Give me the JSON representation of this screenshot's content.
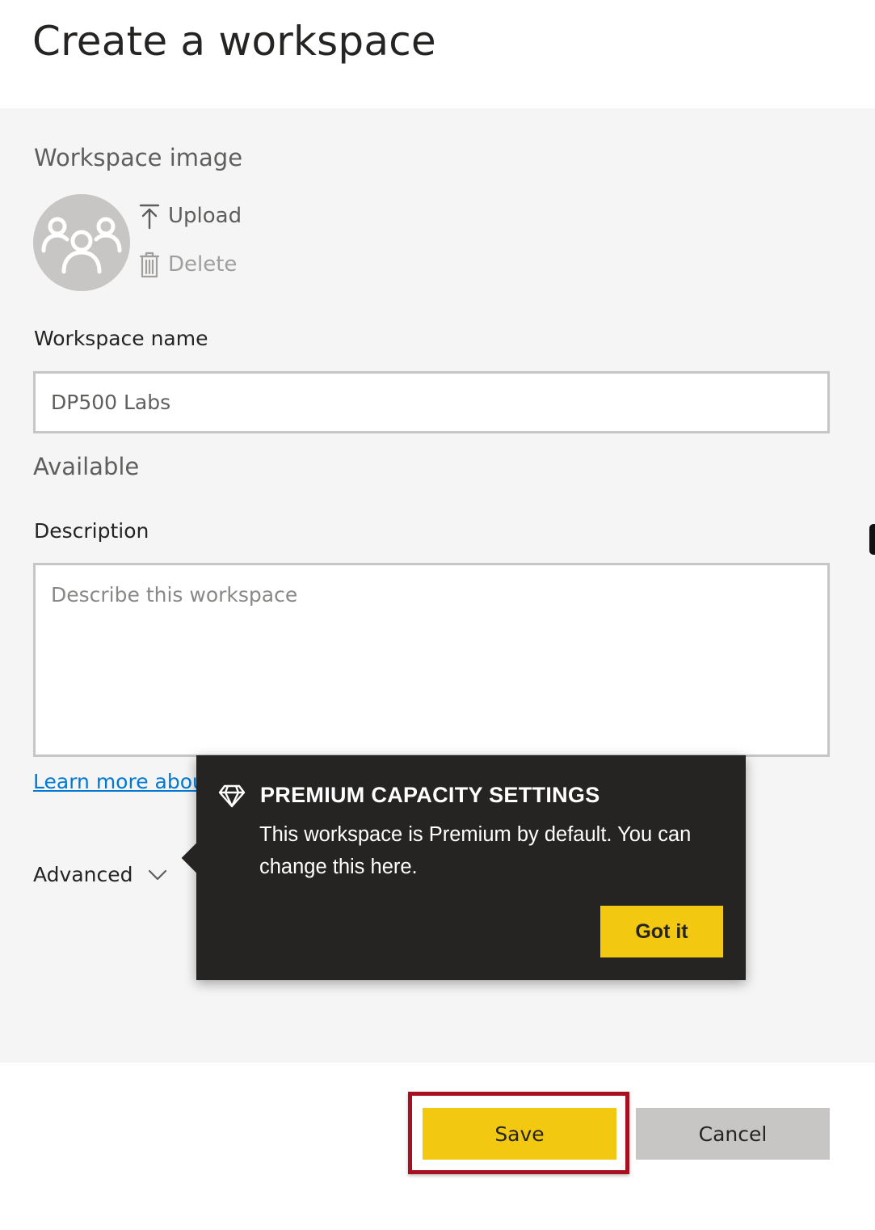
{
  "dialog": {
    "title": "Create a workspace"
  },
  "image_section": {
    "label": "Workspace image",
    "avatar_icon": "group-people-icon",
    "upload_label": "Upload",
    "upload_icon": "upload-arrow-icon",
    "delete_label": "Delete",
    "delete_icon": "trash-icon"
  },
  "name_field": {
    "label": "Workspace name",
    "value": "DP500 Labs",
    "availability": "Available"
  },
  "description_field": {
    "label": "Description",
    "placeholder": "Describe this workspace"
  },
  "learn_more_link": "Learn more abou",
  "advanced": {
    "label": "Advanced",
    "icon": "chevron-down-icon"
  },
  "teaching_bubble": {
    "icon": "diamond-icon",
    "title": "PREMIUM CAPACITY SETTINGS",
    "body": "This workspace is Premium by default. You can change this here.",
    "button_label": "Got it"
  },
  "footer": {
    "save_label": "Save",
    "cancel_label": "Cancel"
  },
  "colors": {
    "accent_yellow": "#f2c811",
    "highlight_red": "#a80f1f",
    "link_blue": "#0078d4",
    "bubble_bg": "#252423",
    "panel_bg": "#f5f5f5"
  }
}
